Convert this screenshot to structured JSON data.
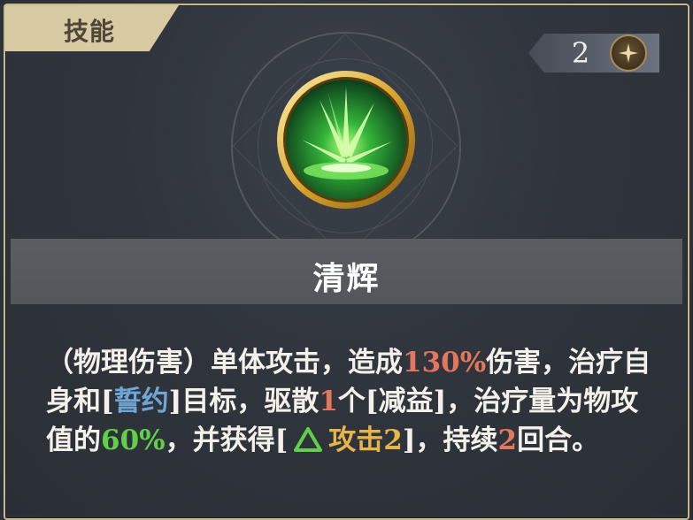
{
  "tab": {
    "label": "技能"
  },
  "counter": {
    "value": "2",
    "icon": "star-coin-icon"
  },
  "skill": {
    "name": "清辉",
    "icon": "green-light-burst-icon"
  },
  "description": {
    "p1": "（物理伤害）单体攻击，造成",
    "v1": "130%",
    "p2": "伤害，治疗自身和[",
    "pledge": "誓约",
    "p3": "]目标，驱散",
    "v2": "1",
    "p4": "个[减益]，治疗量为物攻值的",
    "v3": "60%",
    "p5": "，并获得[",
    "buff": "攻击2",
    "p6": "]，持续",
    "v4": "2",
    "p7": "回合。"
  },
  "colors": {
    "accent_gold": "#d8cba3",
    "damage_red": "#e2775c",
    "heal_green": "#61cf4a",
    "pledge_blue": "#6fa6d6",
    "buff_gold": "#e7b44a"
  }
}
